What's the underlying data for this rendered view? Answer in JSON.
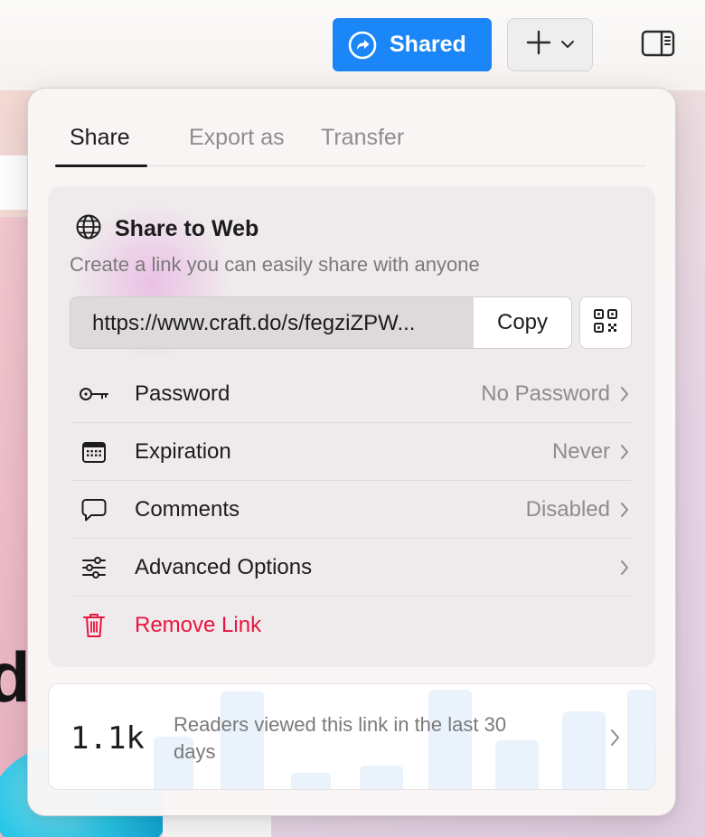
{
  "toolbar": {
    "shared_label": "Shared",
    "shared_icon": "share-arrow-icon",
    "add_icon": "plus-icon",
    "add_menu_icon": "chevron-down-icon",
    "sidebar_icon": "sidebar-toggle-icon",
    "accent_color": "#1a86f7"
  },
  "background": {
    "partial_text": "d"
  },
  "popover": {
    "tabs": [
      {
        "label": "Share",
        "active": true
      },
      {
        "label": "Export as",
        "active": false
      },
      {
        "label": "Transfer",
        "active": false
      }
    ],
    "share_to_web": {
      "icon": "globe-icon",
      "title": "Share to Web",
      "description": "Create a link you can easily share with anyone",
      "url": "https://www.craft.do/s/fegziZPW...",
      "copy_label": "Copy",
      "qr_icon": "qr-code-icon"
    },
    "options": [
      {
        "icon": "key-icon",
        "label": "Password",
        "value": "No Password"
      },
      {
        "icon": "calendar-icon",
        "label": "Expiration",
        "value": "Never"
      },
      {
        "icon": "comment-icon",
        "label": "Comments",
        "value": "Disabled"
      },
      {
        "icon": "sliders-icon",
        "label": "Advanced Options",
        "value": ""
      },
      {
        "icon": "trash-icon",
        "label": "Remove Link",
        "value": "",
        "danger_color": "#e8163e"
      }
    ],
    "stats": {
      "count": "1.1k",
      "text": "Readers viewed this link in the last 30 days"
    }
  }
}
